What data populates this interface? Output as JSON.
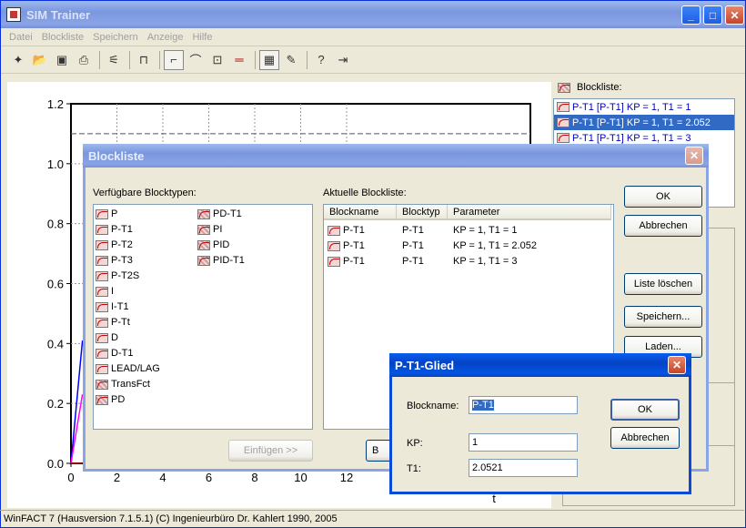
{
  "app": {
    "title": "SIM Trainer",
    "menu": [
      "Datei",
      "Blockliste",
      "Speichern",
      "Anzeige",
      "Hilfe"
    ],
    "status": "WinFACT 7 (Hausversion 7.1.5.1)  (C) Ingenieurbüro Dr. Kahlert 1990, 2005"
  },
  "caption_buttons": {
    "minimize": "_",
    "maximize": "□",
    "close": "✕"
  },
  "toolbar_icons": [
    "new-icon",
    "open-icon",
    "save-icon",
    "print-icon",
    "simulate-icon",
    "axis-icon",
    "step-response-icon",
    "impulse-response-icon",
    "ramp-response-icon",
    "line-icon",
    "grid-icon",
    "config-icon",
    "help-icon",
    "exit-icon"
  ],
  "right_panel": {
    "label": "Blockliste:",
    "items": [
      "P-T1 [P-T1] KP = 1, T1 = 1",
      "P-T1 [P-T1] KP = 1, T1 = 2.052",
      "P-T1 [P-T1] KP = 1, T1 = 3"
    ],
    "selected_index": 1
  },
  "chart_data": {
    "type": "line",
    "xlabel": "t",
    "ylabel": "",
    "xlim": [
      0,
      20
    ],
    "ylim": [
      0,
      1.2
    ],
    "x_ticks": [
      "0",
      "2",
      "4",
      "6",
      "8",
      "10",
      "12"
    ],
    "y_ticks": [
      "0.0",
      "0.2",
      "0.4",
      "0.6",
      "0.8",
      "1.0",
      "1.2"
    ],
    "grid": true,
    "reference_line": 1.1,
    "series": [
      {
        "color": "#0000ff",
        "x": [
          0,
          0.5
        ],
        "y": [
          0,
          0.41
        ]
      },
      {
        "color": "#ff00ff",
        "x": [
          0,
          0.5
        ],
        "y": [
          0,
          0.23
        ]
      },
      {
        "color": "#c00000",
        "x": [
          0,
          0.5
        ],
        "y": [
          0,
          0.0
        ]
      }
    ]
  },
  "blockliste_dialog": {
    "title": "Blockliste",
    "available_label": "Verfügbare Blocktypen:",
    "current_label": "Aktuelle Blockliste:",
    "available_col1": [
      "P",
      "P-T1",
      "P-T2",
      "P-T3",
      "P-T2S",
      "I",
      "I-T1",
      "P-Tt",
      "D",
      "D-T1",
      "LEAD/LAG",
      "TransFct",
      "PD"
    ],
    "available_col2": [
      "PD-T1",
      "PI",
      "PID",
      "PID-T1"
    ],
    "columns": [
      "Blockname",
      "Blocktyp",
      "Parameter"
    ],
    "rows": [
      {
        "name": "P-T1",
        "type": "P-T1",
        "params": "KP = 1, T1 = 1"
      },
      {
        "name": "P-T1",
        "type": "P-T1",
        "params": "KP = 1, T1 = 2.052"
      },
      {
        "name": "P-T1",
        "type": "P-T1",
        "params": "KP = 1, T1 = 3"
      }
    ],
    "buttons": {
      "ok": "OK",
      "cancel": "Abbrechen",
      "clear": "Liste löschen",
      "save": "Speichern...",
      "load": "Laden...",
      "insert": "Einfügen >>",
      "edit_fragment": "B"
    }
  },
  "pt1_dialog": {
    "title": "P-T1-Glied",
    "blockname_label": "Blockname:",
    "blockname_value": "P-T1",
    "kp_label": "KP:",
    "kp_value": "1",
    "t1_label": "T1:",
    "t1_value": "2.0521",
    "ok": "OK",
    "cancel": "Abbrechen"
  }
}
